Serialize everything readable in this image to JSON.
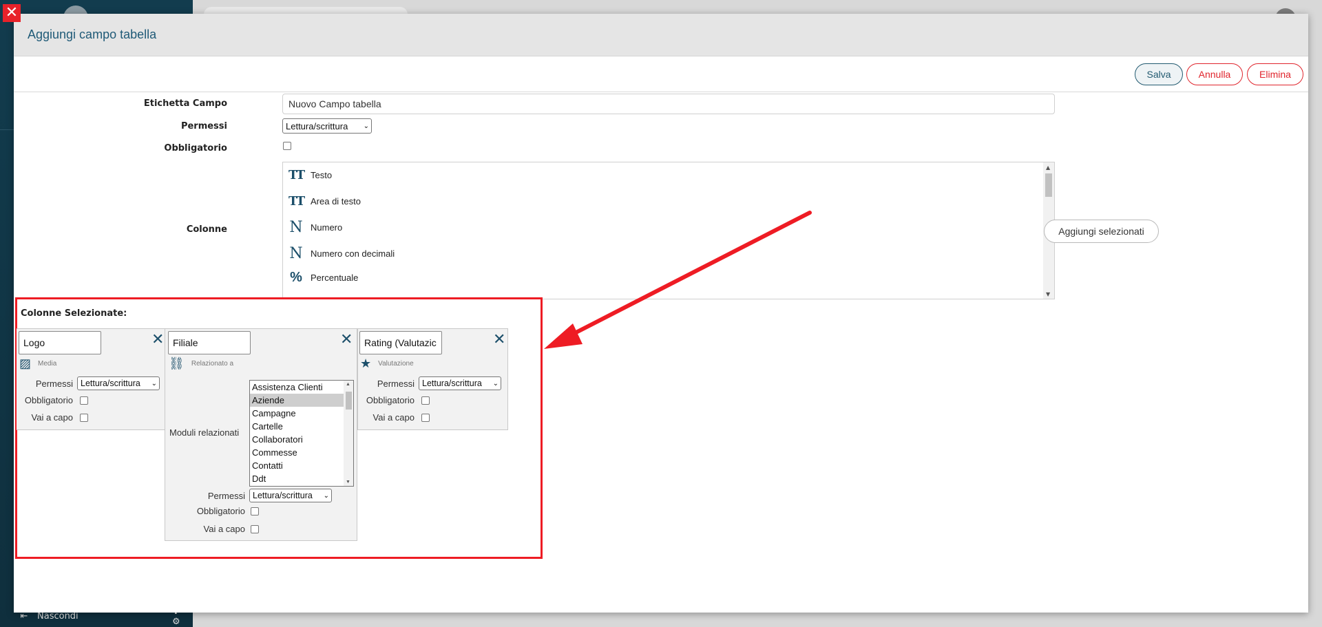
{
  "background": {
    "sidebar_footer_label": "Nascondi"
  },
  "modal": {
    "title": "Aggiungi campo tabella",
    "buttons": {
      "save": "Salva",
      "cancel": "Annulla",
      "delete": "Elimina"
    }
  },
  "form": {
    "etichetta_label": "Etichetta Campo",
    "etichetta_value": "Nuovo Campo tabella",
    "permessi_label": "Permessi",
    "permessi_value": "Lettura/scrittura",
    "obbligatorio_label": "Obbligatorio",
    "obbligatorio_checked": false,
    "colonne_label": "Colonne",
    "column_types": [
      {
        "icon": "text-type-icon",
        "label": "Testo"
      },
      {
        "icon": "text-type-icon",
        "label": "Area di testo"
      },
      {
        "icon": "number-icon",
        "label": "Numero"
      },
      {
        "icon": "number-icon",
        "label": "Numero con decimali"
      },
      {
        "icon": "percent-icon",
        "label": "Percentuale"
      }
    ],
    "add_selected_label": "Aggiungi selezionati"
  },
  "selected": {
    "title": "Colonne Selezionate:",
    "columns": [
      {
        "name": "Logo",
        "type_label": "Media",
        "type_icon": "image-icon",
        "permessi_label": "Permessi",
        "permessi_value": "Lettura/scrittura",
        "obbligatorio_label": "Obbligatorio",
        "vai_a_capo_label": "Vai a capo"
      },
      {
        "name": "Filiale",
        "type_label": "Relazionato a",
        "type_icon": "link-icon",
        "moduli_label": "Moduli relazionati",
        "moduli_options": [
          "Assistenza Clienti",
          "Aziende",
          "Campagne",
          "Cartelle",
          "Collaboratori",
          "Commesse",
          "Contatti",
          "Ddt"
        ],
        "moduli_selected": "Aziende",
        "permessi_label": "Permessi",
        "permessi_value": "Lettura/scrittura",
        "obbligatorio_label": "Obbligatorio",
        "vai_a_capo_label": "Vai a capo"
      },
      {
        "name": "Rating (Valutazic",
        "type_label": "Valutazione",
        "type_icon": "star-icon",
        "permessi_label": "Permessi",
        "permessi_value": "Lettura/scrittura",
        "obbligatorio_label": "Obbligatorio",
        "vai_a_capo_label": "Vai a capo"
      }
    ]
  },
  "colors": {
    "accent": "#1c4f6a",
    "danger": "#e0242c",
    "annotation": "#ee1c24"
  }
}
